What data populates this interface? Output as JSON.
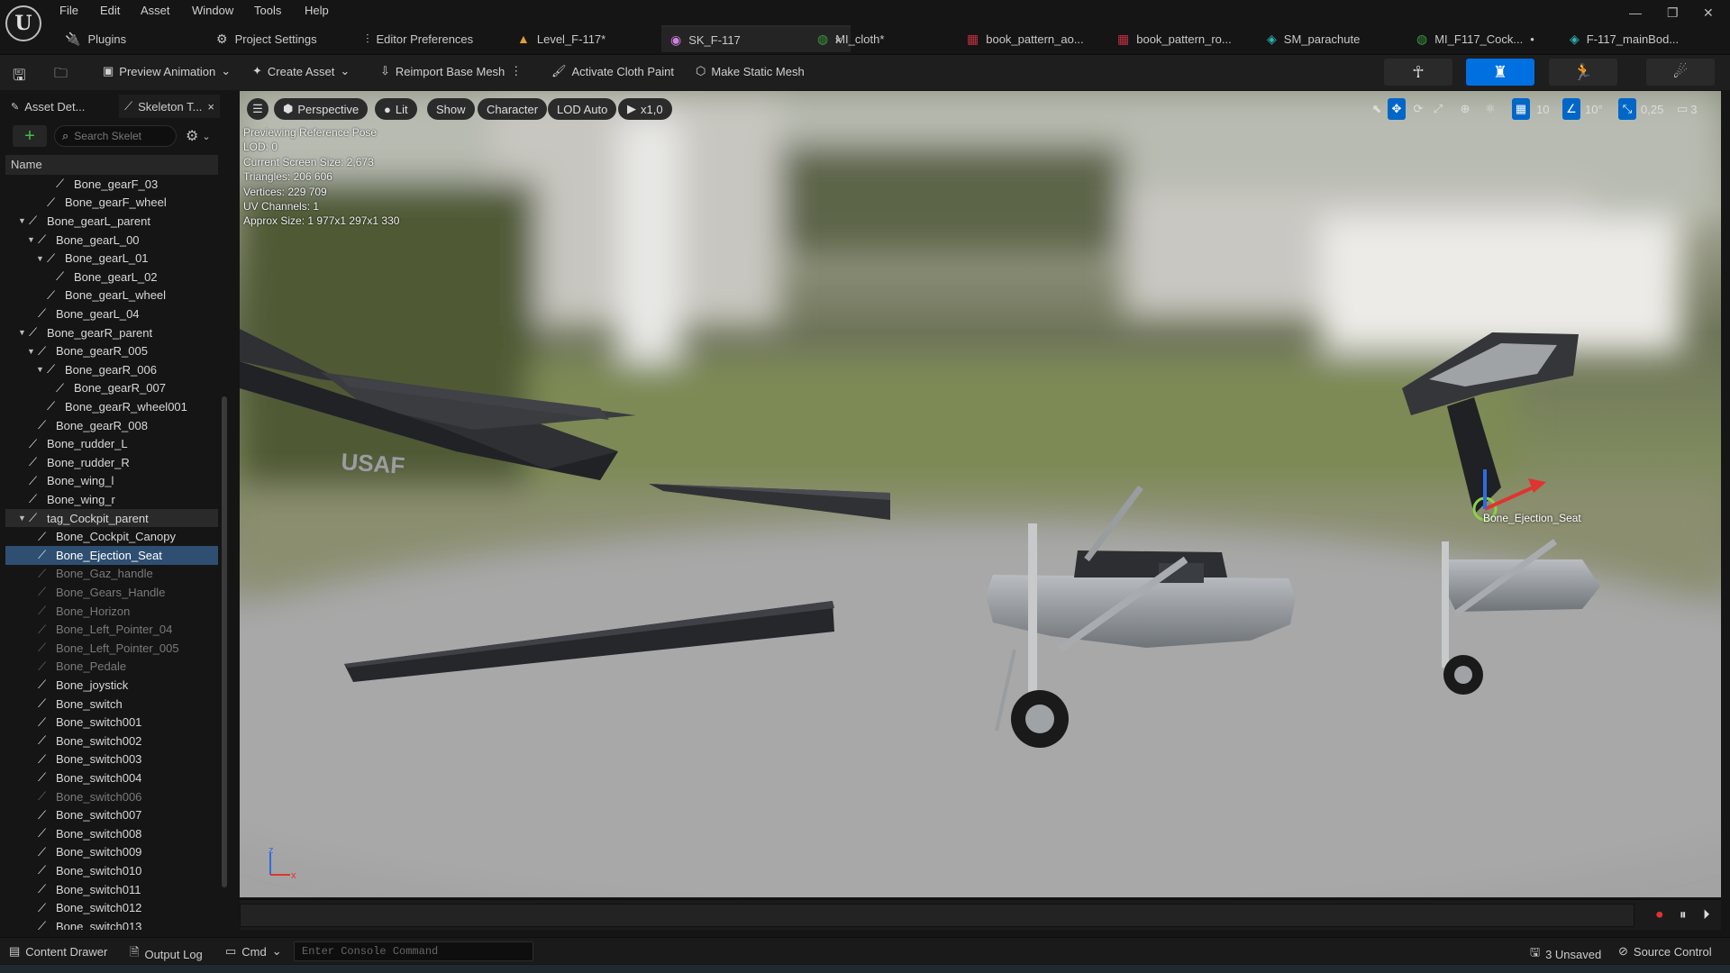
{
  "menu": {
    "items": [
      "File",
      "Edit",
      "Asset",
      "Window",
      "Tools",
      "Help"
    ],
    "logo": "U"
  },
  "tabs": [
    {
      "label": "Plugins",
      "icon": "plugin-icon"
    },
    {
      "label": "Project Settings",
      "icon": "gear-icon"
    },
    {
      "label": "Editor Preferences",
      "icon": "sliders-icon"
    },
    {
      "label": "Level_F-117*",
      "icon": "level-icon"
    },
    {
      "label": "SK_F-117",
      "icon": "skeletal-mesh-icon",
      "close": "×"
    },
    {
      "label": "MI_cloth*",
      "icon": "material-instance-icon"
    },
    {
      "label": "book_pattern_ao...",
      "icon": "texture-icon"
    },
    {
      "label": "book_pattern_ro...",
      "icon": "texture-icon"
    },
    {
      "label": "SM_parachute",
      "icon": "static-mesh-icon"
    },
    {
      "label": "MI_F117_Cock...",
      "icon": "material-instance-icon",
      "close": "•"
    },
    {
      "label": "F-117_mainBod...",
      "icon": "static-mesh-icon"
    }
  ],
  "toolbar": {
    "preview_animation": "Preview Animation",
    "create_asset": "Create Asset",
    "reimport": "Reimport Base Mesh",
    "cloth_paint": "Activate Cloth Paint",
    "make_static": "Make Static Mesh"
  },
  "left_panel": {
    "tab_asset_details": "Asset Det...",
    "tab_skeleton_tree": "Skeleton T...",
    "close": "×",
    "search_placeholder": "Search Skelet",
    "column_name": "Name",
    "add": "+"
  },
  "bones": [
    {
      "name": "Bone_gearF_03",
      "depth": 4,
      "expander": "",
      "state": ""
    },
    {
      "name": "Bone_gearF_wheel",
      "depth": 3,
      "expander": "",
      "state": ""
    },
    {
      "name": "Bone_gearL_parent",
      "depth": 1,
      "expander": "▼",
      "state": ""
    },
    {
      "name": "Bone_gearL_00",
      "depth": 2,
      "expander": "▼",
      "state": ""
    },
    {
      "name": "Bone_gearL_01",
      "depth": 3,
      "expander": "▼",
      "state": ""
    },
    {
      "name": "Bone_gearL_02",
      "depth": 4,
      "expander": "",
      "state": ""
    },
    {
      "name": "Bone_gearL_wheel",
      "depth": 3,
      "expander": "",
      "state": ""
    },
    {
      "name": "Bone_gearL_04",
      "depth": 2,
      "expander": "",
      "state": ""
    },
    {
      "name": "Bone_gearR_parent",
      "depth": 1,
      "expander": "▼",
      "state": ""
    },
    {
      "name": "Bone_gearR_005",
      "depth": 2,
      "expander": "▼",
      "state": ""
    },
    {
      "name": "Bone_gearR_006",
      "depth": 3,
      "expander": "▼",
      "state": ""
    },
    {
      "name": "Bone_gearR_007",
      "depth": 4,
      "expander": "",
      "state": ""
    },
    {
      "name": "Bone_gearR_wheel001",
      "depth": 3,
      "expander": "",
      "state": ""
    },
    {
      "name": "Bone_gearR_008",
      "depth": 2,
      "expander": "",
      "state": ""
    },
    {
      "name": "Bone_rudder_L",
      "depth": 1,
      "expander": "",
      "state": ""
    },
    {
      "name": "Bone_rudder_R",
      "depth": 1,
      "expander": "",
      "state": ""
    },
    {
      "name": "Bone_wing_l",
      "depth": 1,
      "expander": "",
      "state": ""
    },
    {
      "name": "Bone_wing_r",
      "depth": 1,
      "expander": "",
      "state": ""
    },
    {
      "name": "tag_Cockpit_parent",
      "depth": 1,
      "expander": "▼",
      "state": "hl"
    },
    {
      "name": "Bone_Cockpit_Canopy",
      "depth": 2,
      "expander": "",
      "state": ""
    },
    {
      "name": "Bone_Ejection_Seat",
      "depth": 2,
      "expander": "",
      "state": "sel"
    },
    {
      "name": "Bone_Gaz_handle",
      "depth": 2,
      "expander": "",
      "state": "dim"
    },
    {
      "name": "Bone_Gears_Handle",
      "depth": 2,
      "expander": "",
      "state": "dim"
    },
    {
      "name": "Bone_Horizon",
      "depth": 2,
      "expander": "",
      "state": "dim"
    },
    {
      "name": "Bone_Left_Pointer_04",
      "depth": 2,
      "expander": "",
      "state": "dim"
    },
    {
      "name": "Bone_Left_Pointer_005",
      "depth": 2,
      "expander": "",
      "state": "dim"
    },
    {
      "name": "Bone_Pedale",
      "depth": 2,
      "expander": "",
      "state": "dim"
    },
    {
      "name": "Bone_joystick",
      "depth": 2,
      "expander": "",
      "state": ""
    },
    {
      "name": "Bone_switch",
      "depth": 2,
      "expander": "",
      "state": ""
    },
    {
      "name": "Bone_switch001",
      "depth": 2,
      "expander": "",
      "state": ""
    },
    {
      "name": "Bone_switch002",
      "depth": 2,
      "expander": "",
      "state": ""
    },
    {
      "name": "Bone_switch003",
      "depth": 2,
      "expander": "",
      "state": ""
    },
    {
      "name": "Bone_switch004",
      "depth": 2,
      "expander": "",
      "state": ""
    },
    {
      "name": "Bone_switch006",
      "depth": 2,
      "expander": "",
      "state": "dim"
    },
    {
      "name": "Bone_switch007",
      "depth": 2,
      "expander": "",
      "state": ""
    },
    {
      "name": "Bone_switch008",
      "depth": 2,
      "expander": "",
      "state": ""
    },
    {
      "name": "Bone_switch009",
      "depth": 2,
      "expander": "",
      "state": ""
    },
    {
      "name": "Bone_switch010",
      "depth": 2,
      "expander": "",
      "state": ""
    },
    {
      "name": "Bone_switch011",
      "depth": 2,
      "expander": "",
      "state": ""
    },
    {
      "name": "Bone_switch012",
      "depth": 2,
      "expander": "",
      "state": ""
    },
    {
      "name": "Bone_switch013",
      "depth": 2,
      "expander": "",
      "state": ""
    }
  ],
  "viewport": {
    "perspective": "Perspective",
    "lit": "Lit",
    "show": "Show",
    "character": "Character",
    "lod": "LOD Auto",
    "speed": "x1,0",
    "grid_snap": "10",
    "rot_snap": "10°",
    "scale_snap": "0,25",
    "cam_speed": "3",
    "stats": [
      "Previewing Reference Pose",
      "LOD: 0",
      "Current Screen Size: 2,673",
      "Triangles: 206 606",
      "Vertices: 229 709",
      "UV Channels: 1",
      "Approx Size: 1 977x1 297x1 330"
    ],
    "usaf_text": "USAF",
    "bone_label": "Bone_Ejection_Seat",
    "axis_z": "z",
    "axis_x": "x"
  },
  "statusbar": {
    "content_drawer": "Content Drawer",
    "output_log": "Output Log",
    "cmd": "Cmd",
    "console_placeholder": "Enter Console Command",
    "unsaved": "3 Unsaved",
    "source_control": "Source Control"
  },
  "colors": {
    "accent": "#0070e0",
    "selection": "#2f4f72",
    "add_green": "#3ec43e"
  }
}
